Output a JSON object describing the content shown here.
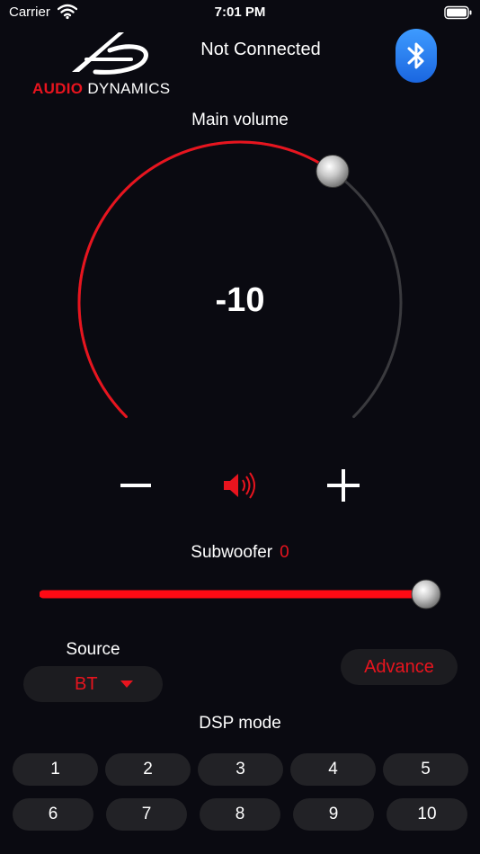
{
  "status_bar": {
    "carrier": "Carrier",
    "time": "7:01 PM"
  },
  "header": {
    "brand_red": "AUDIO",
    "brand_white": "DYNAMICS",
    "connection_status": "Not Connected"
  },
  "volume": {
    "label": "Main volume",
    "value": "-10",
    "level_fraction": 0.63,
    "minus_label": "−",
    "plus_label": "+"
  },
  "subwoofer": {
    "label": "Subwoofer",
    "value": "0",
    "level_fraction": 1.0
  },
  "source": {
    "label": "Source",
    "selected": "BT"
  },
  "advance": {
    "label": "Advance"
  },
  "dsp": {
    "label": "DSP mode",
    "row1": [
      "1",
      "2",
      "3",
      "4",
      "5"
    ],
    "row2": [
      "6",
      "7",
      "8",
      "9",
      "10"
    ]
  },
  "colors": {
    "accent": "#e8141e",
    "background": "#0a0a11",
    "button": "#222226",
    "bluetooth": "#2a7df0"
  }
}
